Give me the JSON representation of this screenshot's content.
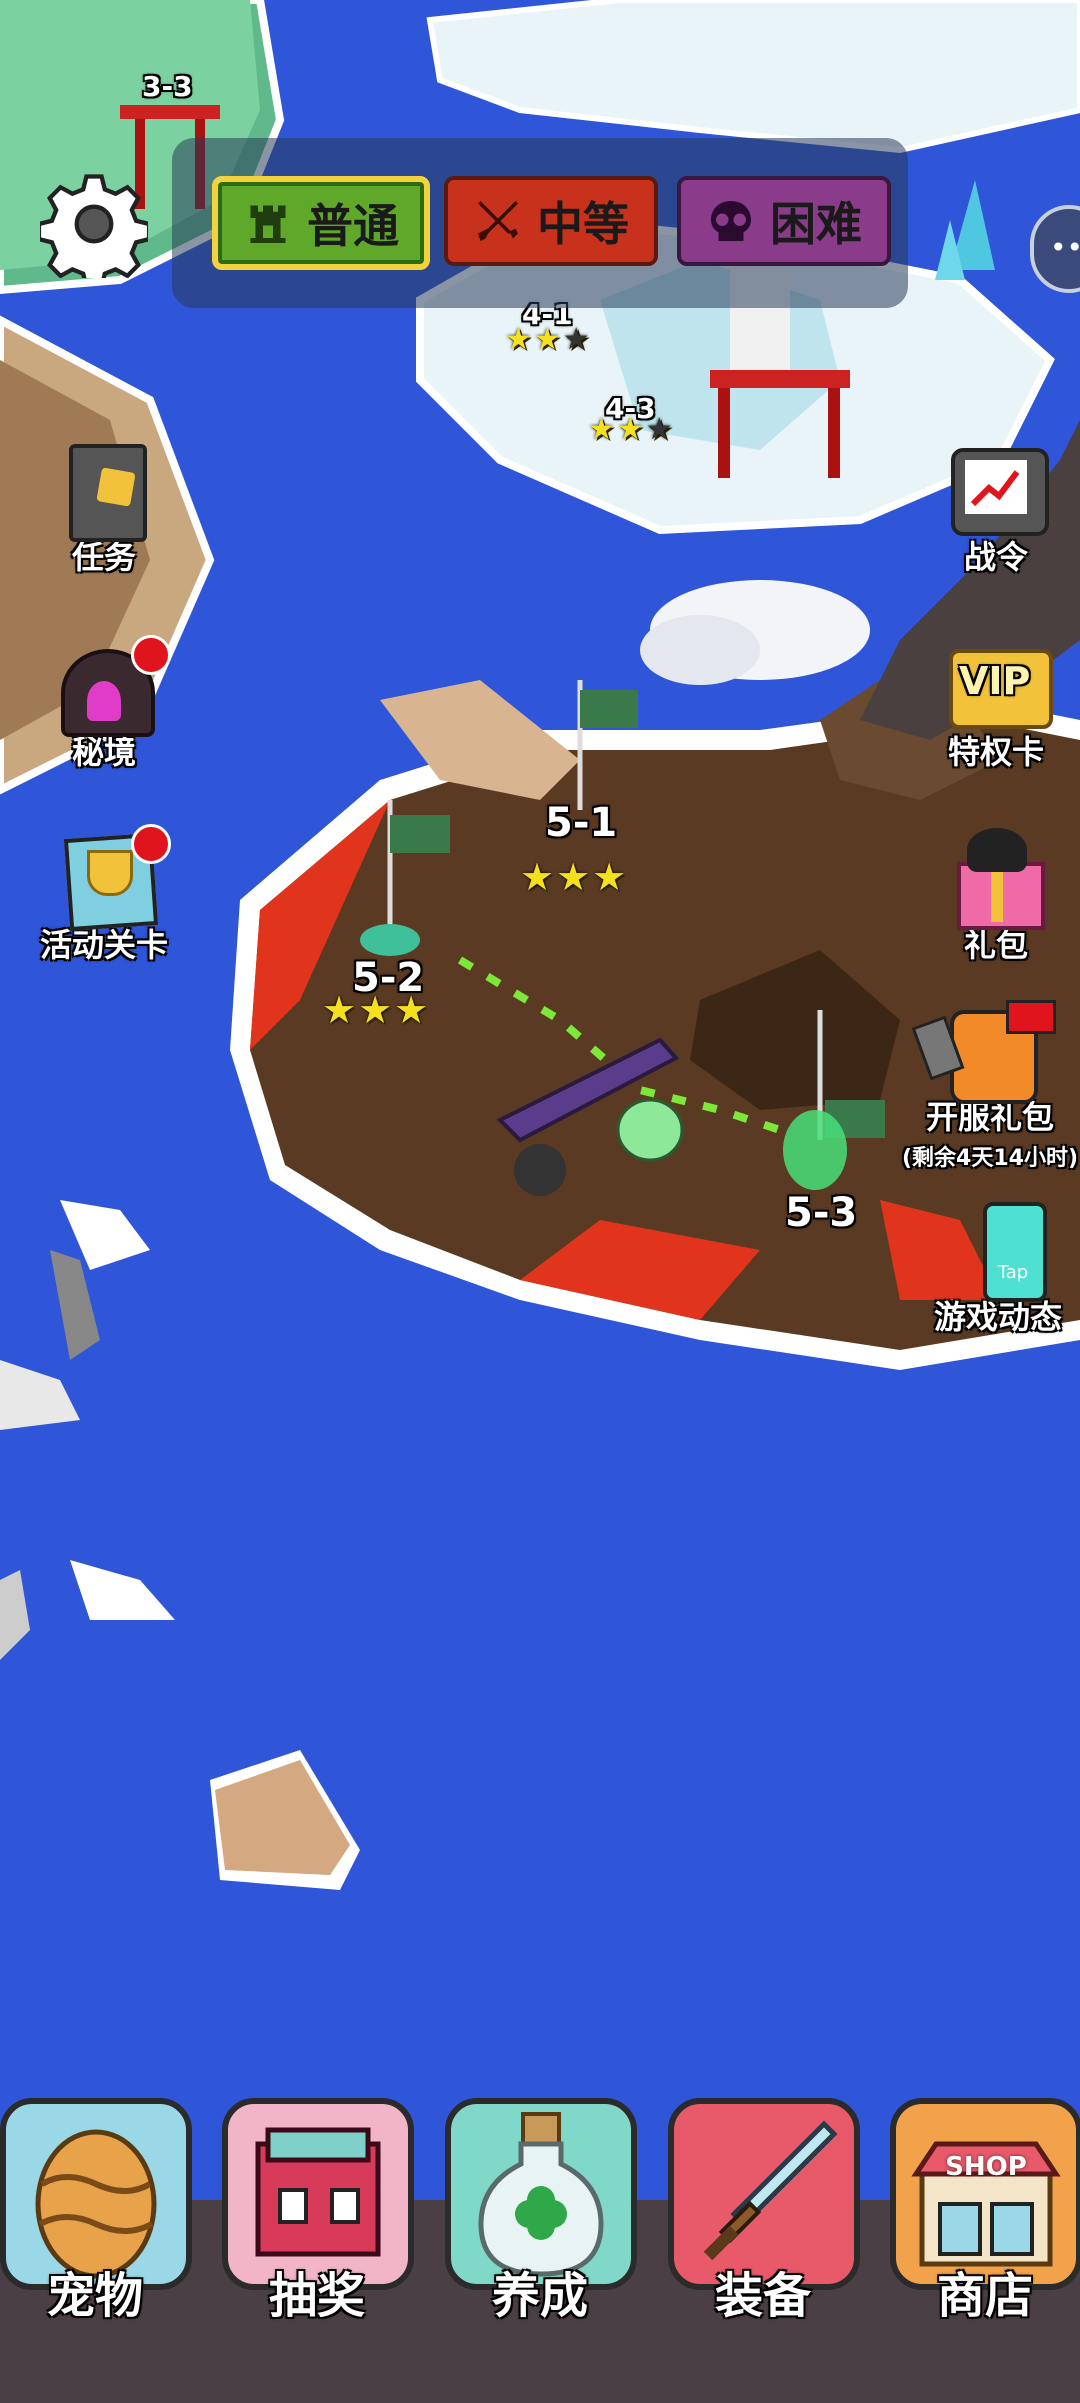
{
  "difficulty": {
    "normal": "普通",
    "medium": "中等",
    "hard": "困难"
  },
  "side_left": {
    "tasks": "任务",
    "secret": "秘境",
    "event_levels": "活动关卡"
  },
  "side_right": {
    "battle_pass": "战令",
    "vip_card": "特权卡",
    "vip_badge": "VIP",
    "gift_pack": "礼包",
    "server_gift": "开服礼包",
    "server_gift_timer": "(剩余4天14小时)",
    "game_news": "游戏动态",
    "tap_badge": "Tap"
  },
  "levels": {
    "l33": "3-3",
    "l41": "4-1",
    "l43": "4-3",
    "l51": "5-1",
    "l52": "5-2",
    "l53": "5-3"
  },
  "stars": {
    "l41": 2,
    "l43": 2,
    "l51": 3,
    "l52": 3
  },
  "bottom_nav": {
    "pet": "宠物",
    "lottery": "抽奖",
    "nurture": "养成",
    "equipment": "装备",
    "shop": "商店",
    "shop_sign": "SHOP"
  },
  "colors": {
    "ocean": "#2f55d8",
    "lava": "#e0341c",
    "island": "#5a3a22",
    "snow": "#e8f4f8"
  }
}
